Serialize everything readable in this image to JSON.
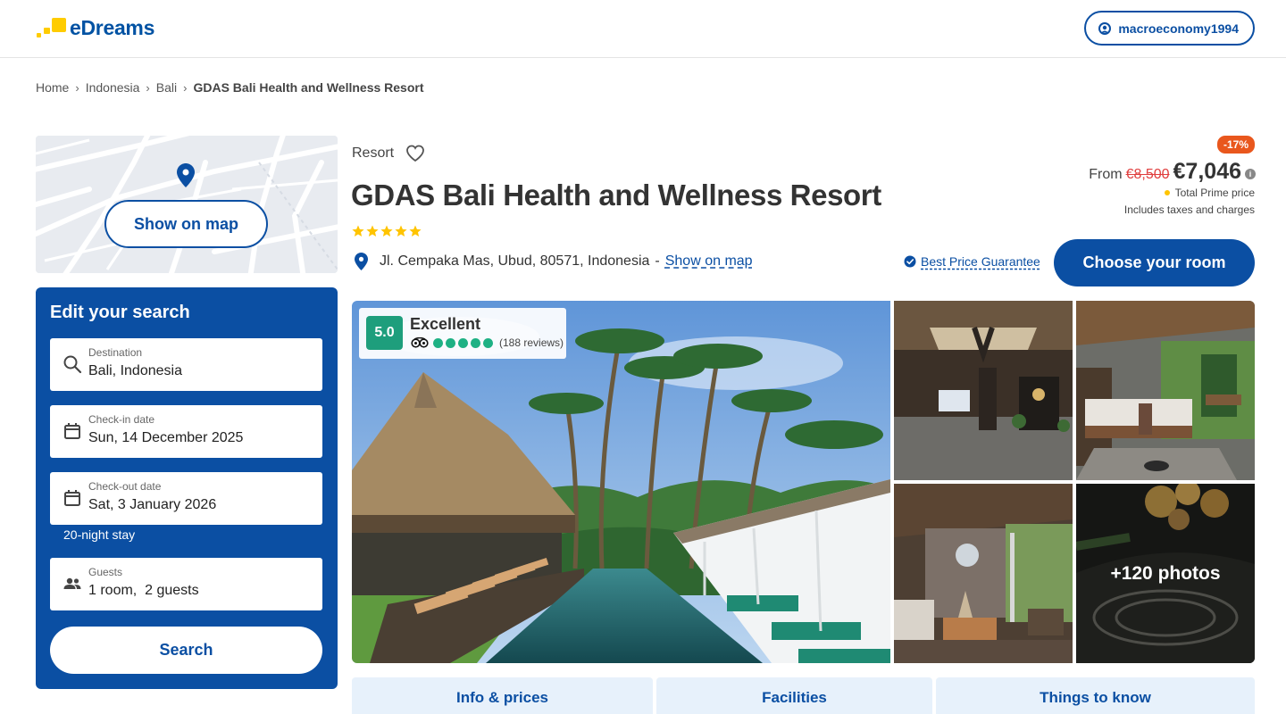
{
  "header": {
    "logo_text": "eDreams",
    "user_name": "macroeconomy1994"
  },
  "breadcrumb": [
    "Home",
    "Indonesia",
    "Bali",
    "GDAS Bali Health and Wellness Resort"
  ],
  "map": {
    "show_on_map_label": "Show on map"
  },
  "search": {
    "title": "Edit your search",
    "destination_label": "Destination",
    "destination_value": "Bali, Indonesia",
    "checkin_label": "Check-in date",
    "checkin_value": "Sun, 14 December 2025",
    "checkout_label": "Check-out date",
    "checkout_value": "Sat, 3 January 2026",
    "stay_note": "20-night stay",
    "guests_label": "Guests",
    "guests_value": "1 room,  2 guests",
    "search_button": "Search"
  },
  "hotel": {
    "type": "Resort",
    "name": "GDAS Bali Health and Wellness Resort",
    "stars": 5,
    "address": "Jl. Cempaka Mas, Ubud, 80571, Indonesia",
    "address_separator": "-",
    "show_on_map_link": "Show on map"
  },
  "price": {
    "discount": "-17%",
    "from_label": "From",
    "old_price": "€8,500",
    "new_price": "€7,046",
    "prime_label": "Total Prime price",
    "taxes_label": "Includes taxes and charges",
    "guarantee_label": "Best Price Guarantee",
    "choose_button": "Choose your room"
  },
  "rating": {
    "score": "5.0",
    "label": "Excellent",
    "dots": 5,
    "reviews": "(188 reviews)"
  },
  "gallery": {
    "more_photos": "+120 photos"
  },
  "tabs": [
    "Info & prices",
    "Facilities",
    "Things to know"
  ],
  "colors": {
    "brand_blue": "#0b4fa3",
    "brand_yellow": "#ffcc00",
    "discount_orange": "#e9571d",
    "rating_green": "#1e9e7c",
    "old_price_red": "#e03d3d"
  }
}
